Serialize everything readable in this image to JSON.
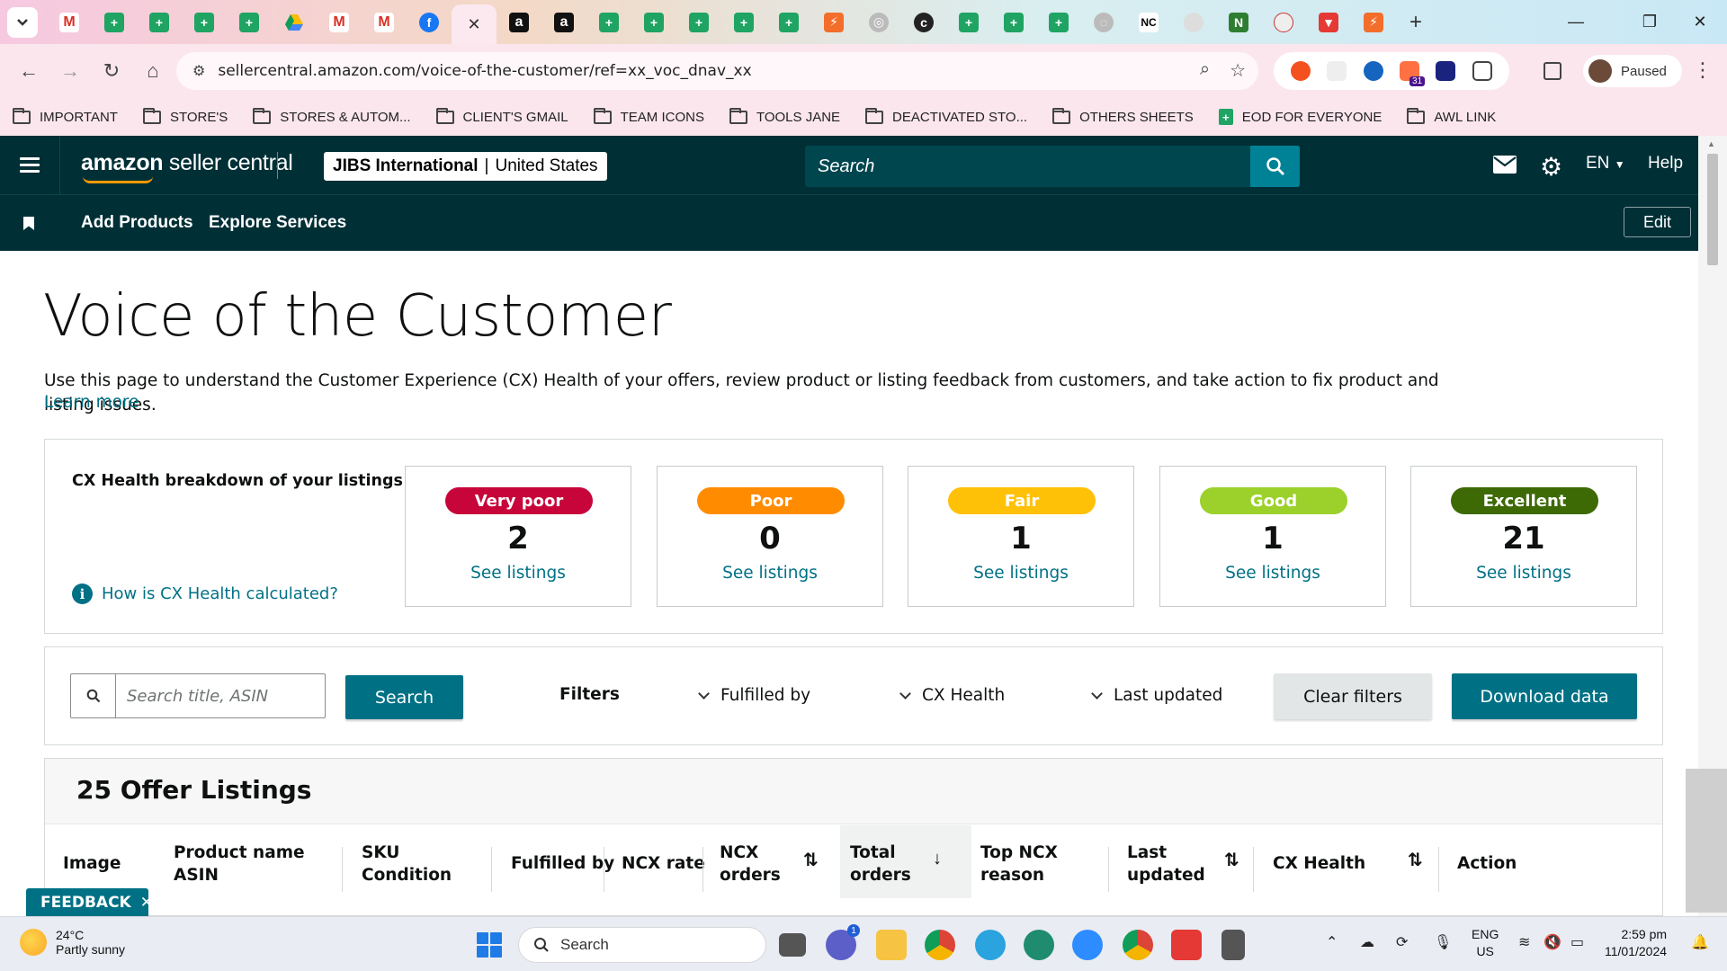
{
  "browser": {
    "url": "sellercentral.amazon.com/voice-of-the-customer/ref=xx_voc_dnav_xx",
    "profile_status": "Paused",
    "bookmarks": [
      {
        "label": "IMPORTANT",
        "icon": "folder-icon"
      },
      {
        "label": "STORE'S",
        "icon": "folder-icon"
      },
      {
        "label": "STORES & AUTOM...",
        "icon": "folder-icon"
      },
      {
        "label": "CLIENT'S GMAIL",
        "icon": "folder-icon"
      },
      {
        "label": "TEAM ICONS",
        "icon": "folder-icon"
      },
      {
        "label": "TOOLS JANE",
        "icon": "folder-icon"
      },
      {
        "label": "DEACTIVATED STO...",
        "icon": "folder-icon"
      },
      {
        "label": "OTHERS SHEETS",
        "icon": "folder-icon"
      },
      {
        "label": "EOD FOR EVERYONE",
        "icon": "sheets-icon"
      },
      {
        "label": "AWL LINK",
        "icon": "folder-icon"
      }
    ],
    "tab_badge": "31"
  },
  "header": {
    "logo_text_bold": "amazon",
    "logo_text": " seller central",
    "store_name": "JIBS International",
    "store_region": "United States",
    "search_placeholder": "Search",
    "language": "EN",
    "help": "Help"
  },
  "subnav": {
    "links": [
      "Add Products",
      "Explore Services"
    ],
    "edit_label": "Edit"
  },
  "page": {
    "title": "Voice of the Customer",
    "description": "Use this page to understand the Customer Experience (CX) Health of your offers, review product or listing feedback from customers, and take action to fix product and listing issues.",
    "learn_more": "Learn more"
  },
  "cx_breakdown": {
    "title": "CX Health breakdown of your listings",
    "how_link": "How is CX Health calculated?",
    "cards": [
      {
        "label": "Very poor",
        "count": "2",
        "link": "See listings",
        "color": "#c7053a"
      },
      {
        "label": "Poor",
        "count": "0",
        "link": "See listings",
        "color": "#ff8c00"
      },
      {
        "label": "Fair",
        "count": "1",
        "link": "See listings",
        "color": "#ffc107"
      },
      {
        "label": "Good",
        "count": "1",
        "link": "See listings",
        "color": "#9bd12a"
      },
      {
        "label": "Excellent",
        "count": "21",
        "link": "See listings",
        "color": "#3d6a05"
      }
    ]
  },
  "filters": {
    "search_placeholder": "Search title, ASIN",
    "search_button": "Search",
    "label": "Filters",
    "dropdowns": [
      "Fulfilled by",
      "CX Health",
      "Last updated"
    ],
    "clear": "Clear filters",
    "download": "Download data"
  },
  "offers": {
    "title": "25 Offer Listings",
    "columns": {
      "image": "Image",
      "product_line1": "Product name",
      "product_line2": "ASIN",
      "sku_line1": "SKU",
      "sku_line2": "Condition",
      "fulfilled": "Fulfilled by",
      "ncx_rate": "NCX rate",
      "ncx_orders_line1": "NCX",
      "ncx_orders_line2": "orders",
      "total_line1": "Total",
      "total_line2": "orders",
      "top_line1": "Top NCX",
      "top_line2": "reason",
      "last_line1": "Last",
      "last_line2": "updated",
      "cx_health": "CX Health",
      "action": "Action"
    }
  },
  "feedback_label": "FEEDBACK",
  "taskbar": {
    "weather_temp": "24°C",
    "weather_desc": "Partly sunny",
    "search_label": "Search",
    "lang_line1": "ENG",
    "lang_line2": "US",
    "time": "2:59 pm",
    "date": "11/01/2024",
    "teams_badge": "1"
  },
  "colors": {
    "amazon_header": "#002f36",
    "accent_teal": "#007185",
    "link": "#007185"
  }
}
